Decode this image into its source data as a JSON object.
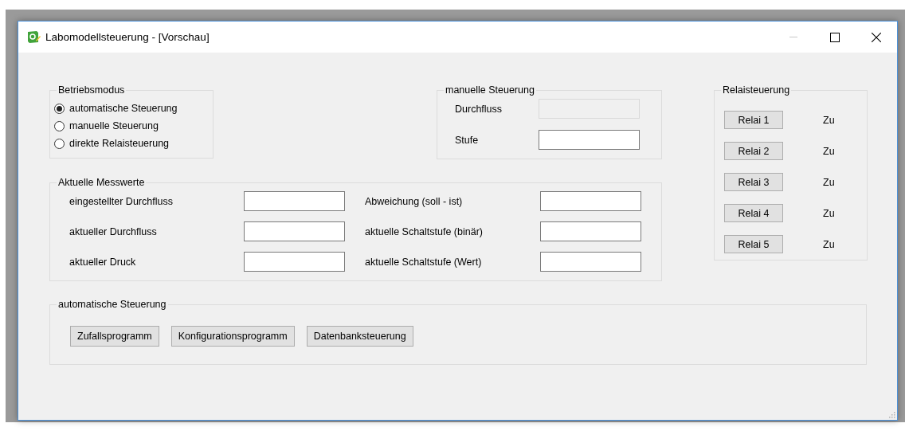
{
  "window": {
    "title": "Labomodellsteuerung - [Vorschau]"
  },
  "betriebsmodus": {
    "title": "Betriebsmodus",
    "options": [
      {
        "label": "automatische Steuerung",
        "selected": true
      },
      {
        "label": "manuelle Steuerung",
        "selected": false
      },
      {
        "label": "direkte Relaisteuerung",
        "selected": false
      }
    ]
  },
  "manuelle_steuerung": {
    "title": "manuelle Steuerung",
    "fields": [
      {
        "label": "Durchfluss",
        "disabled": true
      },
      {
        "label": "Stufe",
        "disabled": false
      }
    ]
  },
  "relaisteuerung": {
    "title": "Relaisteuerung",
    "relays": [
      {
        "button": "Relai 1",
        "status": "Zu"
      },
      {
        "button": "Relai 2",
        "status": "Zu"
      },
      {
        "button": "Relai 3",
        "status": "Zu"
      },
      {
        "button": "Relai 4",
        "status": "Zu"
      },
      {
        "button": "Relai 5",
        "status": "Zu"
      }
    ]
  },
  "aktuelle_messwerte": {
    "title": "Aktuelle Messwerte",
    "fields": [
      {
        "label": "eingestellter Durchfluss"
      },
      {
        "label": "Abweichung (soll - ist)"
      },
      {
        "label": "aktueller Durchfluss"
      },
      {
        "label": "aktuelle Schaltstufe (binär)"
      },
      {
        "label": "aktueller Druck"
      },
      {
        "label": "aktuelle Schaltstufe (Wert)"
      }
    ]
  },
  "automatische_steuerung": {
    "title": "automatische Steuerung",
    "buttons": [
      "Zufallsprogramm",
      "Konfigurationsprogramm",
      "Datenbanksteuerung"
    ]
  }
}
